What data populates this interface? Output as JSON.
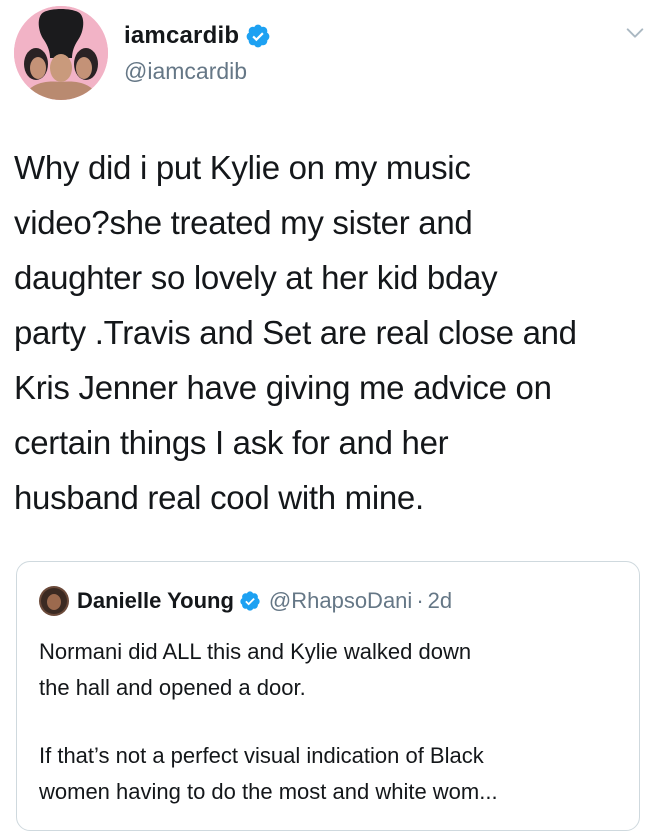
{
  "author": {
    "display_name": "iamcardib",
    "handle": "@iamcardib",
    "verified": true
  },
  "tweet": {
    "lines": [
      "Why did i put Kylie on my music",
      "video?she treated my sister and",
      "daughter so lovely at her kid bday",
      "party .Travis and Set are real close and",
      "Kris Jenner have giving me advice on",
      "certain things I ask for and her",
      "husband real cool with mine."
    ]
  },
  "quoted_tweet": {
    "display_name": "Danielle Young",
    "handle": "@RhapsoDani",
    "separator": "·",
    "time": "2d",
    "verified": true,
    "paragraph1": [
      "Normani did ALL this and Kylie walked down",
      "the hall and opened a door."
    ],
    "paragraph2": [
      "If that’s not a perfect visual indication of Black",
      "women having to do the most and white wom..."
    ]
  },
  "icons": {
    "verified": "verified-badge-icon",
    "menu": "chevron-down-icon"
  },
  "colors": {
    "verified_blue": "#1da1f2",
    "secondary_text": "#657786",
    "primary_text": "#14171a",
    "card_border": "#cfd9de",
    "avatar_bg": "#f2b3c6"
  }
}
